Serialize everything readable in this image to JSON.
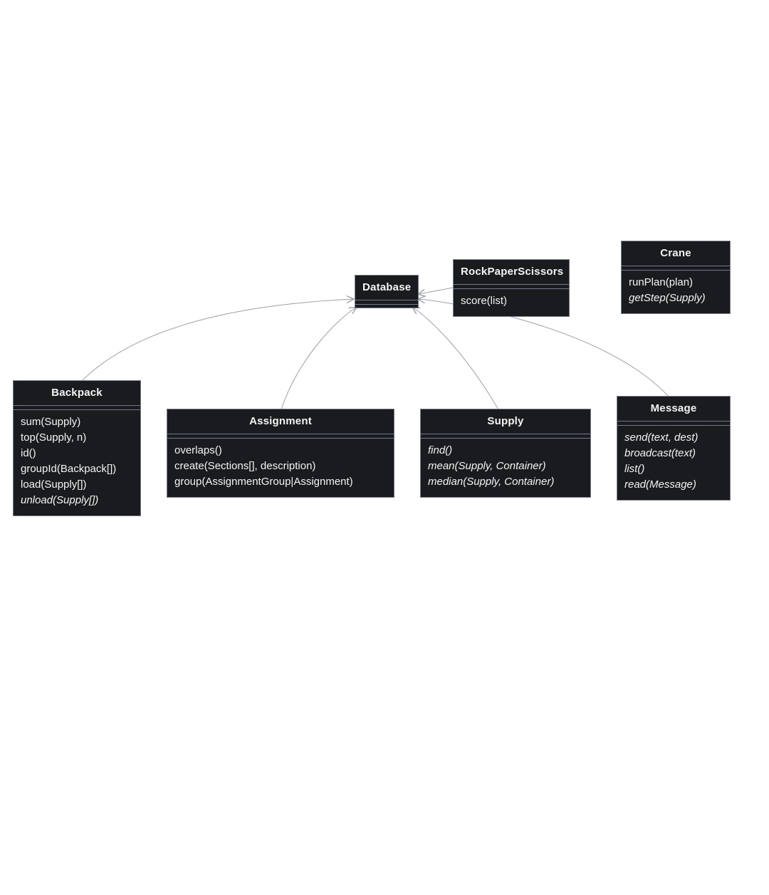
{
  "classes": {
    "database": {
      "name": "Database",
      "methods": []
    },
    "rps": {
      "name": "RockPaperScissors",
      "methods": [
        "score(list)"
      ]
    },
    "crane": {
      "name": "Crane",
      "methods": [
        "runPlan(plan)",
        "getStep(Supply)"
      ]
    },
    "craneItalic": [
      false,
      true
    ],
    "backpack": {
      "name": "Backpack",
      "methods": [
        "sum(Supply)",
        "top(Supply, n)",
        "id()",
        "groupId(Backpack[])",
        "load(Supply[])",
        "unload(Supply[])"
      ]
    },
    "backpackItalic": [
      false,
      false,
      false,
      false,
      false,
      true
    ],
    "assignment": {
      "name": "Assignment",
      "methods": [
        "overlaps()",
        "create(Sections[], description)",
        "group(AssignmentGroup|Assignment)"
      ]
    },
    "supply": {
      "name": "Supply",
      "methods": [
        "find()",
        "mean(Supply, Container)",
        "median(Supply, Container)"
      ]
    },
    "supplyItalic": [
      true,
      true,
      true
    ],
    "message": {
      "name": "Message",
      "methods": [
        "send(text, dest)",
        "broadcast(text)",
        "list()",
        "read(Message)"
      ]
    },
    "messageItalic": [
      true,
      true,
      true,
      true
    ]
  }
}
